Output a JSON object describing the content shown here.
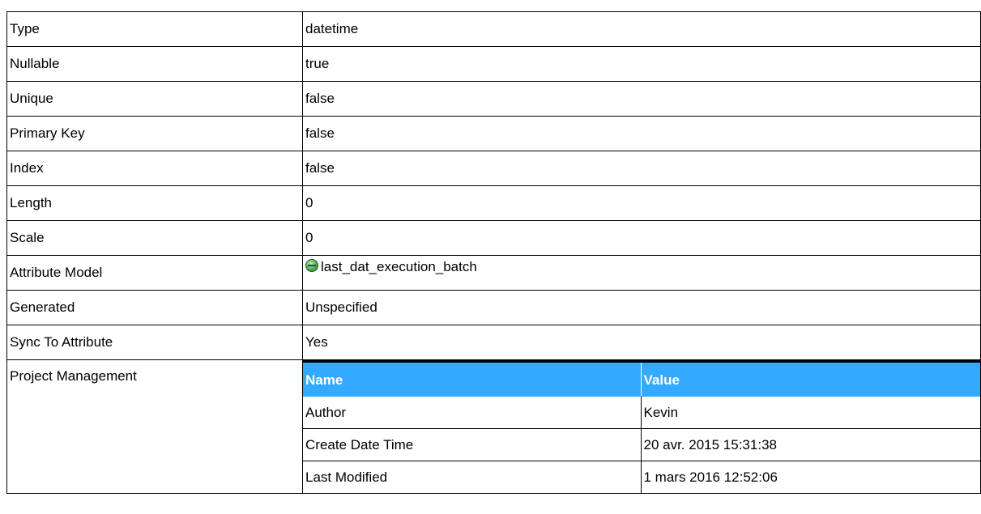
{
  "rows": [
    {
      "label": "Type",
      "value": "datetime"
    },
    {
      "label": "Nullable",
      "value": "true"
    },
    {
      "label": "Unique",
      "value": "false"
    },
    {
      "label": "Primary Key",
      "value": "false"
    },
    {
      "label": "Index",
      "value": "false"
    },
    {
      "label": "Length",
      "value": "0"
    },
    {
      "label": "Scale",
      "value": "0"
    },
    {
      "label": "Attribute Model",
      "value": "last_dat_execution_batch",
      "icon": "attribute-icon"
    },
    {
      "label": "Generated",
      "value": "Unspecified"
    },
    {
      "label": "Sync To Attribute",
      "value": "Yes"
    }
  ],
  "project_management": {
    "label": "Project Management",
    "headers": {
      "name": "Name",
      "value": "Value"
    },
    "items": [
      {
        "name": "Author",
        "value": "Kevin"
      },
      {
        "name": "Create Date Time",
        "value": "20 avr. 2015 15:31:38"
      },
      {
        "name": "Last Modified",
        "value": "1 mars 2016 12:52:06"
      }
    ]
  },
  "colors": {
    "header_bg": "#33aaff",
    "header_text": "#ffffff"
  }
}
